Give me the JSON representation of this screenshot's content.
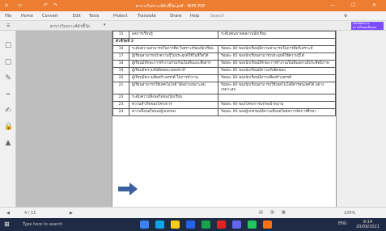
{
  "window": {
    "title": "ตารางวิเคราะห์ตัวชี้วัด.pdf - WPS PDF",
    "controls": [
      "—",
      "☐",
      "✕"
    ]
  },
  "menu": [
    "File",
    "Home",
    "Convert",
    "Edit",
    "Tools",
    "Protect",
    "Translate",
    "Share",
    "Help"
  ],
  "search_placeholder": "Search",
  "tab_label": "ตารางวิเคราะห์ตัวชี้วัด",
  "tooltip": "เลือกข้อความ ดาวน์โหลดเพื่อแปล",
  "table": {
    "first_row": {
      "n": "15",
      "name": "ผลการเรียนรู้",
      "desc": "ระดับคุณภาพผลงานนักเรียน"
    },
    "section": "ตัวชี้วัดที่ 2",
    "rows": [
      {
        "n": "16",
        "name": "ระดับความสามารถในการคิด วิเคราะห์ของนักเรียน",
        "desc": "ร้อยละ 80 ของนักเรียนมีความสามารถในการคิดวิเคราะห์"
      },
      {
        "n": "17",
        "name": "ผู้เรียนสามารถนำความรู้ไปประยุกต์ใช้ในชีวิตได้",
        "desc": "ร้อยละ 85 ของนักเรียนสามารถประยุกต์ใช้ความรู้ได้"
      },
      {
        "n": "18",
        "name": "ผู้เรียนมีทักษะการทำงานร่วมกันเป็นทีมและสื่อสาร",
        "desc": "ร้อยละ 80 ของนักเรียนมีทักษะการทำงานเป็นทีมอย่างมีประสิทธิภาพ"
      },
      {
        "n": "19",
        "name": "ผู้เรียนมีความรับผิดชอบ ต่อหน้าที่",
        "desc": "ร้อยละ 85 ของนักเรียนมีความรับผิดชอบ"
      },
      {
        "n": "20",
        "name": "ผู้เรียนมีความคิดสร้างสรรค์ ในการทำงาน",
        "desc": "ร้อยละ 80 ของนักเรียนมีความคิดสร้างสรรค์"
      },
      {
        "n": "21",
        "name": "ผู้เรียนสามารถใช้เทคโนโลยี ได้อย่างเหมาะสม",
        "desc": "ร้อยละ 80 ของนักเรียนสามารถใช้เทคโนโลยีสารสนเทศได้ อย่างเหมาะสม"
      },
      {
        "n": "22",
        "name": "ระดับความพึงพอใจของนักเรียน",
        "desc": ""
      },
      {
        "n": "23",
        "name": "ความสำเร็จของโครงการ",
        "desc": "ร้อยละ 90 ของโครงการบรรลุเป้าหมาย"
      },
      {
        "n": "24",
        "name": "ความพึงพอใจของผู้ปกครอง",
        "desc": "ร้อยละ 90 ของผู้ปกครองมีความพึงพอใจต่อการจัดการศึกษา"
      }
    ]
  },
  "status": {
    "page": "4 / 11",
    "zoom": "100%"
  },
  "taskbar": {
    "search": "Type here to search",
    "time": "9:14",
    "date": "20/09/2021",
    "lang": "ENG"
  }
}
